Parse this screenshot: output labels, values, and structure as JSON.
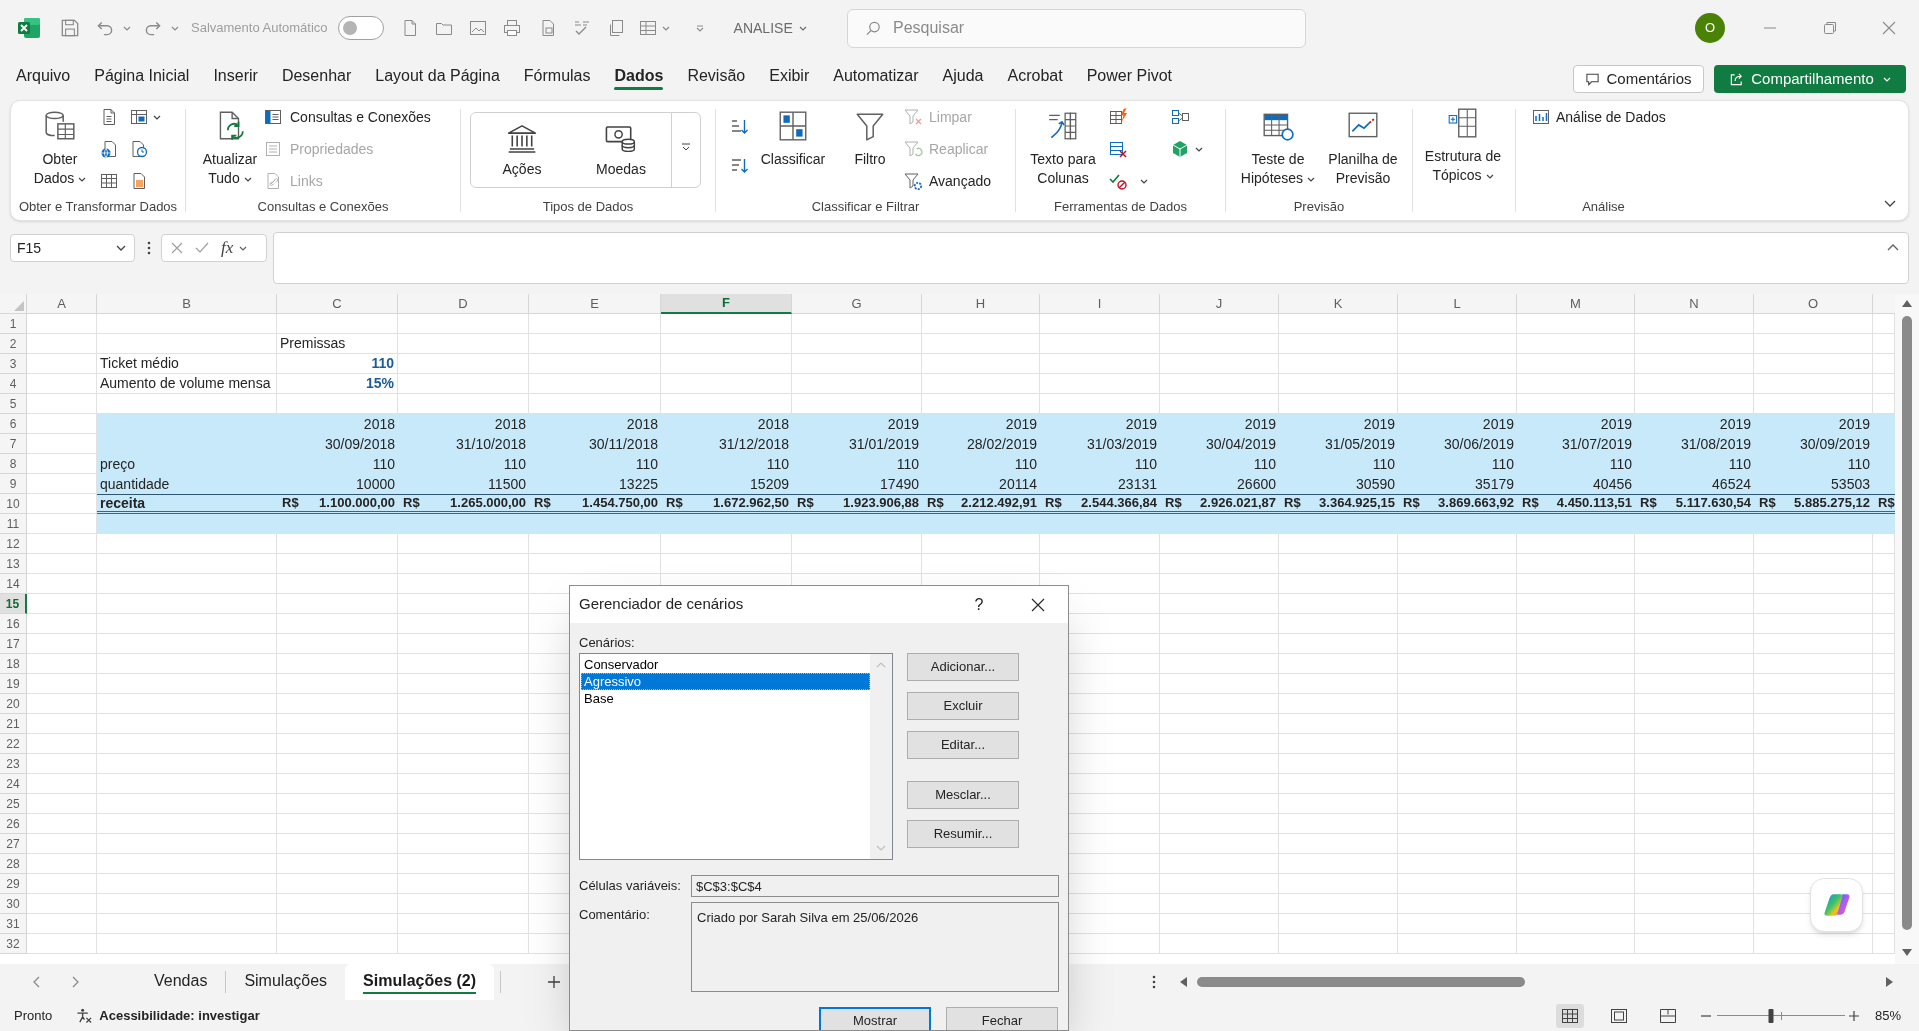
{
  "title_bar": {
    "autosave": {
      "label": "Salvamento Automático",
      "on": false
    },
    "file_name": "ANALISE",
    "search": {
      "placeholder": "Pesquisar"
    },
    "account_initial": "O"
  },
  "menu_tabs": [
    {
      "label": "Arquivo",
      "selected": false
    },
    {
      "label": "Página Inicial",
      "selected": false
    },
    {
      "label": "Inserir",
      "selected": false
    },
    {
      "label": "Desenhar",
      "selected": false
    },
    {
      "label": "Layout da Página",
      "selected": false
    },
    {
      "label": "Fórmulas",
      "selected": false
    },
    {
      "label": "Dados",
      "selected": true
    },
    {
      "label": "Revisão",
      "selected": false
    },
    {
      "label": "Exibir",
      "selected": false
    },
    {
      "label": "Automatizar",
      "selected": false
    },
    {
      "label": "Ajuda",
      "selected": false
    },
    {
      "label": "Acrobat",
      "selected": false
    },
    {
      "label": "Power Pivot",
      "selected": false
    }
  ],
  "comments_button": "Comentários",
  "share_button": "Compartilhamento",
  "ribbon": {
    "groups": [
      {
        "label": "Obter e Transformar Dados",
        "commands": [
          {
            "lines": [
              "Obter",
              "Dados"
            ],
            "disabled": false
          }
        ]
      },
      {
        "label": "Consultas e Conexões",
        "commands": [
          {
            "lines": [
              "Atualizar",
              "Tudo"
            ],
            "disabled": false
          },
          {
            "lines": [
              "Consultas e Conexões"
            ],
            "disabled": false
          },
          {
            "lines": [
              "Propriedades"
            ],
            "disabled": true
          },
          {
            "lines": [
              "Links"
            ],
            "disabled": true
          }
        ]
      },
      {
        "label": "Tipos de Dados",
        "commands": [
          {
            "lines": [
              "Ações"
            ],
            "disabled": false
          },
          {
            "lines": [
              "Moedas"
            ],
            "disabled": false
          }
        ]
      },
      {
        "label": "Classificar e Filtrar",
        "commands": [
          {
            "lines": [
              "Classificar"
            ],
            "disabled": false
          },
          {
            "lines": [
              "Filtro"
            ],
            "disabled": false
          },
          {
            "lines": [
              "Limpar"
            ],
            "disabled": true
          },
          {
            "lines": [
              "Reaplicar"
            ],
            "disabled": true
          },
          {
            "lines": [
              "Avançado"
            ],
            "disabled": false
          }
        ]
      },
      {
        "label": "Ferramentas de Dados",
        "commands": [
          {
            "lines": [
              "Texto para",
              "Colunas"
            ],
            "disabled": false
          }
        ]
      },
      {
        "label": "Previsão",
        "commands": [
          {
            "lines": [
              "Teste de",
              "Hipóteses"
            ],
            "disabled": false
          },
          {
            "lines": [
              "Planilha de",
              "Previsão"
            ],
            "disabled": false
          }
        ]
      },
      {
        "commands": [
          {
            "lines": [
              "Estrutura de",
              "Tópicos"
            ],
            "disabled": false
          }
        ]
      },
      {
        "label": "Análise",
        "commands": [
          {
            "lines": [
              "Análise de Dados"
            ],
            "disabled": false
          }
        ]
      }
    ]
  },
  "formula_bar": {
    "name_box": "F15",
    "function_button": "fx"
  },
  "sheet": {
    "columns": [
      {
        "label": "A",
        "selected": false
      },
      {
        "label": "B",
        "selected": false
      },
      {
        "label": "C",
        "selected": false
      },
      {
        "label": "D",
        "selected": false
      },
      {
        "label": "E",
        "selected": false
      },
      {
        "label": "F",
        "selected": true
      },
      {
        "label": "G",
        "selected": false
      },
      {
        "label": "H",
        "selected": false
      },
      {
        "label": "I",
        "selected": false
      },
      {
        "label": "J",
        "selected": false
      },
      {
        "label": "K",
        "selected": false
      },
      {
        "label": "L",
        "selected": false
      },
      {
        "label": "M",
        "selected": false
      },
      {
        "label": "N",
        "selected": false
      },
      {
        "label": "O",
        "selected": false
      }
    ],
    "rows": [
      {
        "label": "1",
        "selected": false
      },
      {
        "label": "2",
        "selected": false
      },
      {
        "label": "3",
        "selected": false
      },
      {
        "label": "4",
        "selected": false
      },
      {
        "label": "5",
        "selected": false
      },
      {
        "label": "6",
        "selected": false
      },
      {
        "label": "7",
        "selected": false
      },
      {
        "label": "8",
        "selected": false
      },
      {
        "label": "9",
        "selected": false
      },
      {
        "label": "10",
        "selected": false
      },
      {
        "label": "11",
        "selected": false
      },
      {
        "label": "12",
        "selected": false
      },
      {
        "label": "13",
        "selected": false
      },
      {
        "label": "14",
        "selected": false
      },
      {
        "label": "15",
        "selected": true
      },
      {
        "label": "16",
        "selected": false
      },
      {
        "label": "17",
        "selected": false
      },
      {
        "label": "18",
        "selected": false
      },
      {
        "label": "19",
        "selected": false
      },
      {
        "label": "20",
        "selected": false
      },
      {
        "label": "21",
        "selected": false
      },
      {
        "label": "22",
        "selected": false
      },
      {
        "label": "23",
        "selected": false
      },
      {
        "label": "24",
        "selected": false
      },
      {
        "label": "25",
        "selected": false
      },
      {
        "label": "26",
        "selected": false
      },
      {
        "label": "27",
        "selected": false
      },
      {
        "label": "28",
        "selected": false
      },
      {
        "label": "29",
        "selected": false
      },
      {
        "label": "30",
        "selected": false
      },
      {
        "label": "31",
        "selected": false
      },
      {
        "label": "32",
        "selected": false
      }
    ],
    "assumptions": {
      "heading": "Premissas",
      "rows": [
        {
          "label": "Ticket médio",
          "value": "110"
        },
        {
          "label": "Aumento de volume mensa",
          "value": "15%"
        }
      ]
    },
    "projection": {
      "years": [
        "2018",
        "2018",
        "2018",
        "2018",
        "2019",
        "2019",
        "2019",
        "2019",
        "2019",
        "2019",
        "2019",
        "2019",
        "2019"
      ],
      "dates": [
        "30/09/2018",
        "31/10/2018",
        "30/11/2018",
        "31/12/2018",
        "31/01/2019",
        "28/02/2019",
        "31/03/2019",
        "30/04/2019",
        "31/05/2019",
        "30/06/2019",
        "31/07/2019",
        "31/08/2019",
        "30/09/2019"
      ],
      "rows": [
        {
          "label": "preço",
          "values": [
            "110",
            "110",
            "110",
            "110",
            "110",
            "110",
            "110",
            "110",
            "110",
            "110",
            "110",
            "110",
            "110"
          ]
        },
        {
          "label": "quantidade",
          "values": [
            "10000",
            "11500",
            "13225",
            "15209",
            "17490",
            "20114",
            "23131",
            "26600",
            "30590",
            "35179",
            "40456",
            "46524",
            "53503"
          ]
        }
      ],
      "total": {
        "label": "receita",
        "values": [
          {
            "currency": "R$",
            "amount": "1.100.000,00"
          },
          {
            "currency": "R$",
            "amount": "1.265.000,00"
          },
          {
            "currency": "R$",
            "amount": "1.454.750,00"
          },
          {
            "currency": "R$",
            "amount": "1.672.962,50"
          },
          {
            "currency": "R$",
            "amount": "1.923.906,88"
          },
          {
            "currency": "R$",
            "amount": "2.212.492,91"
          },
          {
            "currency": "R$",
            "amount": "2.544.366,84"
          },
          {
            "currency": "R$",
            "amount": "2.926.021,87"
          },
          {
            "currency": "R$",
            "amount": "3.364.925,15"
          },
          {
            "currency": "R$",
            "amount": "3.869.663,92"
          },
          {
            "currency": "R$",
            "amount": "4.450.113,51"
          },
          {
            "currency": "R$",
            "amount": "5.117.630,54"
          },
          {
            "currency": "R$",
            "amount": "5.885.275,12"
          },
          {
            "currency": "R$"
          }
        ]
      }
    }
  },
  "sheet_tabs": [
    {
      "label": "Vendas",
      "selected": false
    },
    {
      "label": "Simulações",
      "selected": false
    },
    {
      "label": "Simulações (2)",
      "selected": true
    }
  ],
  "status_bar": {
    "status": "Pronto",
    "accessibility": "Acessibilidade: investigar",
    "views": [
      {
        "kind": "normal",
        "selected": true
      },
      {
        "kind": "page_layout",
        "selected": false
      },
      {
        "kind": "page_break",
        "selected": false
      }
    ],
    "zoom": {
      "level": 0.42,
      "label": "85%"
    }
  },
  "dialog": {
    "title": "Gerenciador de cenários",
    "help": "?",
    "list_label": "Cenários:",
    "scenarios": [
      {
        "label": "Conservador",
        "selected": false
      },
      {
        "label": "Agressivo",
        "selected": true
      },
      {
        "label": "Base",
        "selected": false
      }
    ],
    "actions": [
      "Adicionar...",
      "Excluir",
      "Editar...",
      "Mesclar...",
      "Resumir..."
    ],
    "changing_cells": {
      "label": "Células variáveis:",
      "value": "$C$3:$C$4"
    },
    "comment": {
      "label": "Comentário:",
      "value": "Criado por Sarah Silva em 25/06/2026"
    },
    "buttons": [
      {
        "label": "Mostrar",
        "default": true
      },
      {
        "label": "Fechar",
        "default": false
      }
    ]
  }
}
